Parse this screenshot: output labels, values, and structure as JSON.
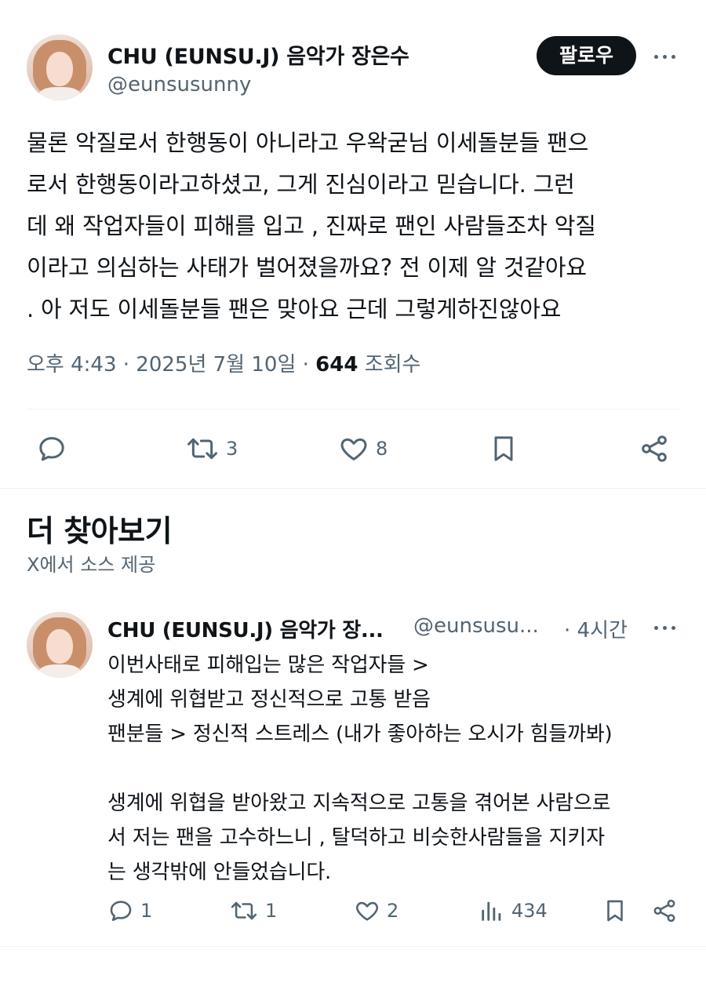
{
  "main_tweet": {
    "author_name": "CHU (EUNSU.J) 음악가 장은수",
    "handle": "@eunsusunny",
    "follow_label": "팔로우",
    "text_lines": [
      "물론 악질로서 한행동이 아니라고 우왁굳님 이세돌분들 팬으",
      "로서 한행동이라고하셨고, 그게 진심이라고 믿습니다. 그런",
      "데 왜 작업자들이 피해를 입고 , 진짜로 팬인 사람들조차 악질",
      "이라고 의심하는 사태가 벌어졌을까요? 전 이제 알 것같아요",
      ". 아 저도 이세돌분들 팬은 맞아요 근데 그렇게하진않아요"
    ],
    "timestamp": "오후 4:43 · 2025년 7월 10일 · ",
    "views_count": "644",
    "views_label": " 조회수",
    "actions": {
      "reply_icon": "reply-icon",
      "retweet_icon": "retweet-icon",
      "retweet_count": "3",
      "like_icon": "heart-icon",
      "like_count": "8",
      "bookmark_icon": "bookmark-icon",
      "share_icon": "share-icon"
    }
  },
  "discover": {
    "title": "더 찾아보기",
    "subtitle": "X에서 소스 제공"
  },
  "reply_tweet": {
    "author_name": "CHU (EUNSU.J) 음악가 장...",
    "handle": "@eunsusu...",
    "time": "· 4시간",
    "text_lines": [
      "이번사태로 피해입는 많은 작업자들 >",
      "생계에 위협받고 정신적으로 고통 받음",
      "팬분들 > 정신적 스트레스 (내가 좋아하는 오시가 힘들까봐)",
      "",
      "생계에 위협을 받아왔고 지속적으로 고통을 겪어본 사람으로",
      "서 저는 팬을 고수하느니 , 탈덕하고 비슷한사람들을 지키자",
      "는 생각밖에 안들었습니다."
    ],
    "actions": {
      "reply_count": "1",
      "retweet_count": "1",
      "like_count": "2",
      "views_count": "434"
    }
  }
}
